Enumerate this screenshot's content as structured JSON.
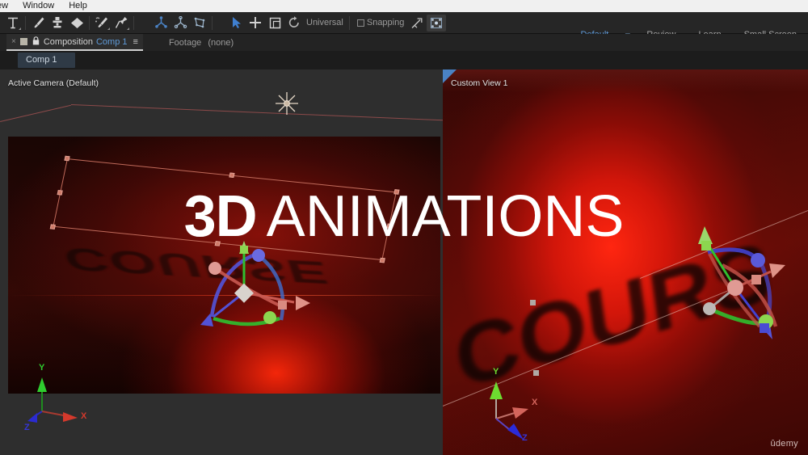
{
  "menu": {
    "items": [
      {
        "label": "ew",
        "name": "menu-view-clipped"
      },
      {
        "label": "Window",
        "name": "menu-window"
      },
      {
        "label": "Help",
        "name": "menu-help"
      }
    ]
  },
  "toolbar": {
    "tools": [
      {
        "name": "text-tool-icon",
        "label": "T"
      },
      {
        "name": "brush-tool-icon",
        "label": "Brush"
      },
      {
        "name": "clone-stamp-tool-icon",
        "label": "Clone Stamp"
      },
      {
        "name": "eraser-tool-icon",
        "label": "Eraser"
      },
      {
        "name": "roto-brush-tool-icon",
        "label": "Roto Brush"
      },
      {
        "name": "puppet-pin-tool-icon",
        "label": "Puppet Pin"
      },
      {
        "name": "rotation-axis-icon",
        "label": "Local Axis Mode"
      },
      {
        "name": "world-axis-icon",
        "label": "World Axis Mode"
      },
      {
        "name": "view-axis-icon",
        "label": "View Axis Mode"
      },
      {
        "name": "selection-tool-icon",
        "label": "Selection Tool"
      },
      {
        "name": "position-tool-icon",
        "label": "Position Tool"
      },
      {
        "name": "scale-tool-icon",
        "label": "Scale Tool"
      },
      {
        "name": "rotation-tool-icon",
        "label": "Rotation Tool"
      }
    ],
    "universal_label": "Universal",
    "snapping_label": "Snapping",
    "snapping_checked": false,
    "extra_tools": [
      {
        "name": "snap-target-icon",
        "label": "Snap Target"
      },
      {
        "name": "transform-box-icon",
        "label": "Transform Box"
      }
    ]
  },
  "workspaces": {
    "items": [
      {
        "label": "Default",
        "active": true
      },
      {
        "label": "Review",
        "active": false
      },
      {
        "label": "Learn",
        "active": false
      },
      {
        "label": "Small Screen",
        "active": false
      }
    ],
    "menu_glyph": "≡"
  },
  "panel_tabs": {
    "close_glyph": "×",
    "lock_glyph": "🔒",
    "composition_label": "Composition",
    "composition_name": "Comp 1",
    "hamburger_glyph": "≡",
    "footage_label": "Footage",
    "footage_value": "(none)"
  },
  "comp_subtab": {
    "label": "Comp 1"
  },
  "viewports": {
    "left": {
      "label": "Active Camera (Default)",
      "scene_text": "COURSE",
      "light_icon": "point-light-icon",
      "axis": {
        "x": "X",
        "y": "Y",
        "z": "Z"
      }
    },
    "right": {
      "label": "Custom View 1",
      "scene_text": "COURS",
      "scene_text_shadow": "COURS",
      "axis": {
        "x": "X",
        "y": "Y",
        "z": "Z"
      }
    }
  },
  "overlay_title": {
    "bold_part": "3D",
    "light_part": "ANIMATIONS"
  },
  "watermark": {
    "text": "ûdemy"
  },
  "colors": {
    "accent_blue": "#5f9ad8",
    "axis_x": "#d43c2e",
    "axis_y": "#35c235",
    "axis_z": "#3a3ad8",
    "panel_bg": "#232323",
    "toolbar_bg": "#262626",
    "viewport_bg": "#2e2e2e",
    "scene_red": "#d6160a",
    "selection": "#c06a5a"
  }
}
